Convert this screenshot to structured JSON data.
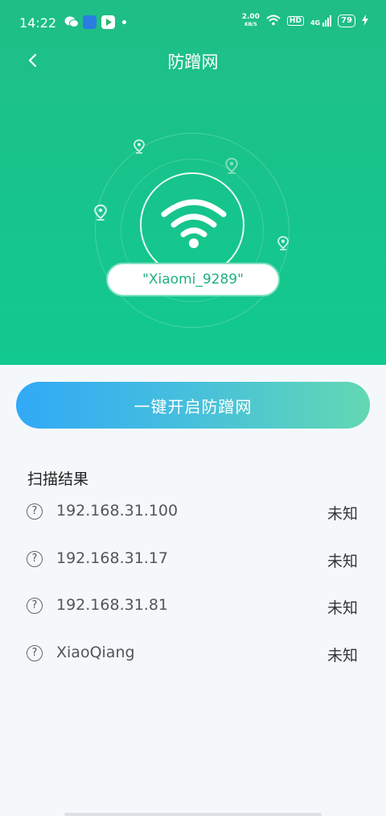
{
  "status_bar": {
    "time": "14:22",
    "net_speed_value": "2.00",
    "net_speed_unit": "KB/S",
    "hd_badge": "HD",
    "network_type": "4G",
    "battery": "79"
  },
  "header": {
    "title": "防蹭网"
  },
  "wifi": {
    "ssid": "\"Xiaomi_9289\""
  },
  "action": {
    "label": "一键开启防蹭网"
  },
  "scan": {
    "title": "扫描结果",
    "items": [
      {
        "name": "192.168.31.100",
        "status": "未知"
      },
      {
        "name": "192.168.31.17",
        "status": "未知"
      },
      {
        "name": "192.168.31.81",
        "status": "未知"
      },
      {
        "name": "XiaoQiang",
        "status": "未知"
      }
    ]
  },
  "colors": {
    "hero_green": "#16c58c",
    "accent_blue": "#31a9f7",
    "accent_teal": "#62d8b3",
    "ssid_text": "#1fb07e"
  },
  "icons": [
    "back-arrow-icon",
    "wifi-icon",
    "location-pin-icon",
    "question-mark-icon"
  ]
}
